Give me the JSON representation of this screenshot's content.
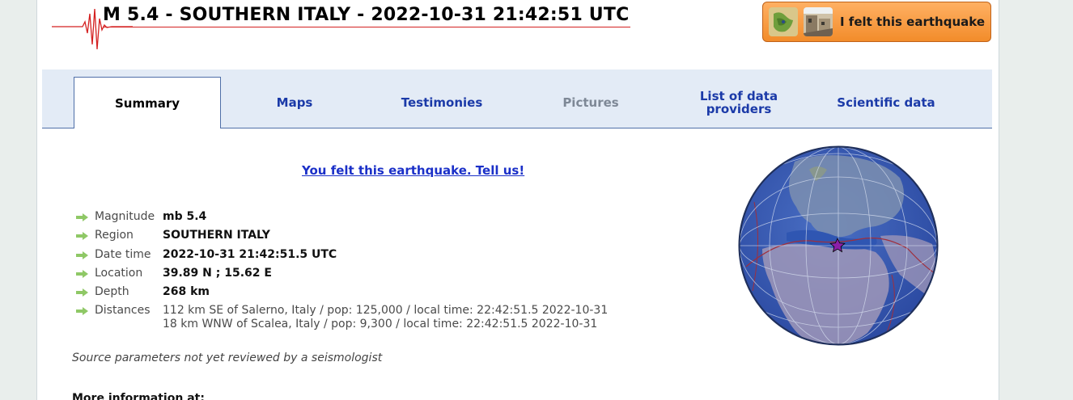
{
  "header": {
    "title": "M 5.4 - SOUTHERN ITALY - 2022-10-31 21:42:51 UTC",
    "felt_button_label": "I felt this earthquake"
  },
  "tabs": [
    {
      "label": "Summary",
      "state": "active"
    },
    {
      "label": "Maps",
      "state": "normal"
    },
    {
      "label": "Testimonies",
      "state": "normal"
    },
    {
      "label": "Pictures",
      "state": "disabled"
    },
    {
      "label": "List of data providers",
      "state": "normal"
    },
    {
      "label": "Scientific data",
      "state": "normal"
    }
  ],
  "felt_link": "You felt this earthquake. Tell us!",
  "details": {
    "magnitude": {
      "label": "Magnitude",
      "value": "mb 5.4"
    },
    "region": {
      "label": "Region",
      "value": "SOUTHERN ITALY"
    },
    "datetime": {
      "label": "Date time",
      "value": "2022-10-31 21:42:51.5 UTC"
    },
    "location": {
      "label": "Location",
      "value": "39.89 N ; 15.62 E"
    },
    "depth": {
      "label": "Depth",
      "value": "268 km"
    },
    "distances": {
      "label": "Distances",
      "lines": [
        "112 km SE of Salerno, Italy / pop: 125,000 / local time: 22:42:51.5 2022-10-31",
        "18 km WNW of Scalea, Italy / pop: 9,300 / local time: 22:42:51.5 2022-10-31"
      ]
    }
  },
  "source_note": "Source parameters not yet reviewed by a seismologist",
  "more_info": "More information at:",
  "colors": {
    "tab_link": "#1b3aa8",
    "tab_bar_bg": "#e3ebf6",
    "felt_button": "#f28c2a",
    "title_underline": "#d42020",
    "epicenter_star": "#8b1fa8"
  }
}
